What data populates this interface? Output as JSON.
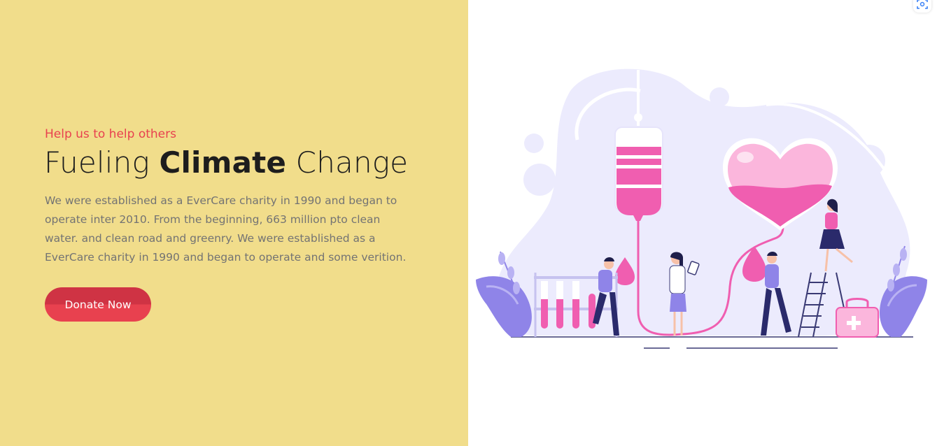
{
  "hero": {
    "eyebrow": "Help us to help others",
    "headline": {
      "part1": "Fueling ",
      "bold": "Climate",
      "part2": " Change"
    },
    "description": "We were established as a EverCare charity in 1990 and began to operate inter 2010. From the beginning, 663 million pto clean water. and clean road and greenry. We were established as a EverCare charity in 1990 and began to operate and some verition.",
    "donate_label": "Donate Now"
  },
  "colors": {
    "left_panel": "#f1dd8b",
    "accent_red": "#e8414f",
    "illustration_pink": "#f05eb0",
    "illustration_lavender": "#8f84e8"
  },
  "icons": {
    "scan": "scan-icon",
    "illustration": "blood-donation-illustration"
  }
}
